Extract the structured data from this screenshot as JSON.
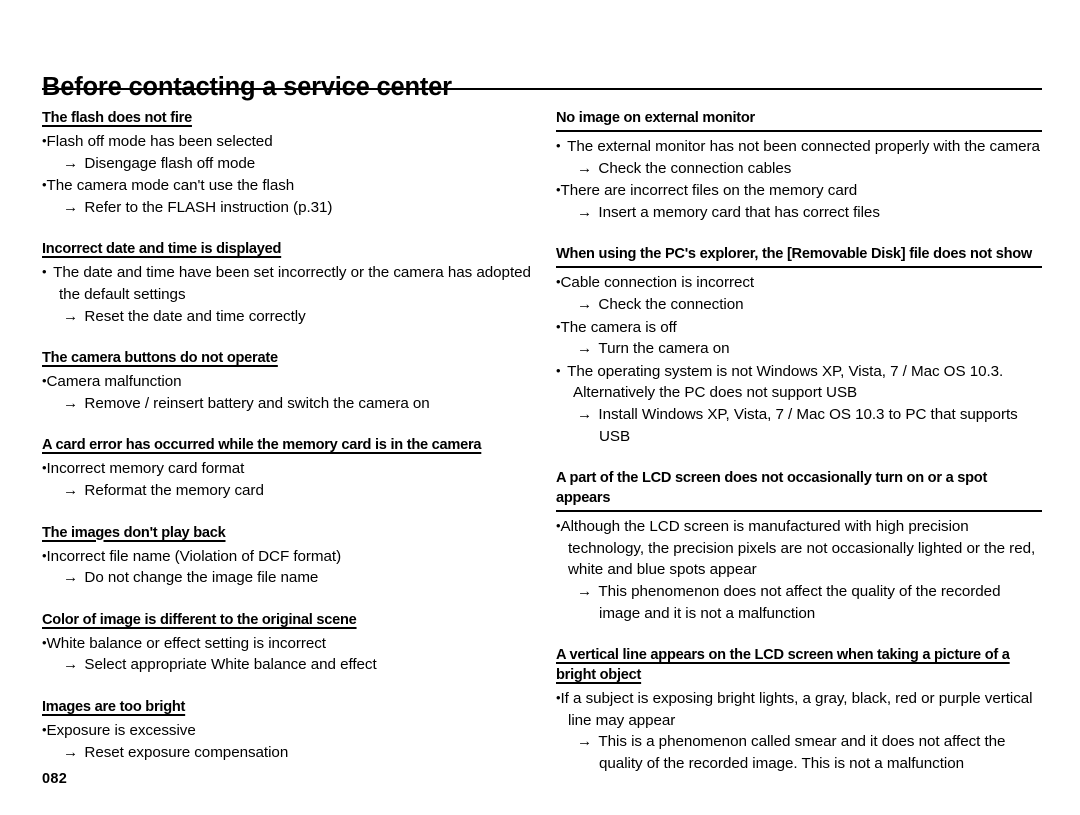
{
  "document": {
    "title": "Before contacting a service center",
    "page_number": "082",
    "bullet_glyph": "•",
    "arrow_glyph": "→"
  },
  "left_column": [
    {
      "heading": "The flash does not fire",
      "heading_style": "underline",
      "items": [
        {
          "type": "bullet",
          "spaced": false,
          "text": "Flash off mode has been selected"
        },
        {
          "type": "arrow",
          "text": "Disengage flash off mode"
        },
        {
          "type": "bullet",
          "spaced": false,
          "text": "The camera mode can't use the flash"
        },
        {
          "type": "arrow",
          "text": "Refer to the FLASH instruction (p.31)"
        }
      ]
    },
    {
      "heading": "Incorrect date and time is displayed",
      "heading_style": "underline",
      "items": [
        {
          "type": "bullet",
          "spaced": true,
          "text": "The date and time have been set incorrectly or the camera has adopted the default settings"
        },
        {
          "type": "arrow",
          "text": "Reset the date and time correctly"
        }
      ]
    },
    {
      "heading": "The camera buttons do not operate",
      "heading_style": "underline",
      "items": [
        {
          "type": "bullet",
          "spaced": false,
          "text": "Camera malfunction"
        },
        {
          "type": "arrow",
          "text": "Remove / reinsert battery and switch the camera on"
        }
      ]
    },
    {
      "heading": "A card error has occurred while the memory card is in the camera",
      "heading_style": "underline",
      "items": [
        {
          "type": "bullet",
          "spaced": false,
          "text": "Incorrect memory card format"
        },
        {
          "type": "arrow",
          "text": "Reformat the memory card"
        }
      ]
    },
    {
      "heading": "The images don't play back",
      "heading_style": "underline",
      "items": [
        {
          "type": "bullet",
          "spaced": false,
          "text": "Incorrect file name (Violation of DCF format)"
        },
        {
          "type": "arrow",
          "text": "Do not change the image file name"
        }
      ]
    },
    {
      "heading": "Color of image is different to the original scene",
      "heading_style": "underline",
      "items": [
        {
          "type": "bullet",
          "spaced": false,
          "text": "White balance or effect setting is incorrect"
        },
        {
          "type": "arrow",
          "text": "Select appropriate White balance and effect"
        }
      ]
    },
    {
      "heading": "Images are too bright",
      "heading_style": "underline",
      "items": [
        {
          "type": "bullet",
          "spaced": false,
          "text": "Exposure is excessive"
        },
        {
          "type": "arrow",
          "text": "Reset exposure compensation"
        }
      ]
    }
  ],
  "right_column": [
    {
      "heading": "No image on external monitor",
      "heading_style": "rule",
      "items": [
        {
          "type": "bullet",
          "spaced": true,
          "text": "The external monitor has not been connected properly with the camera"
        },
        {
          "type": "arrow",
          "text": "Check the connection cables"
        },
        {
          "type": "bullet",
          "spaced": false,
          "text": "There are incorrect files on the memory card"
        },
        {
          "type": "arrow",
          "text": "Insert a memory card that has correct files"
        }
      ]
    },
    {
      "heading": "When using the PC's explorer, the [Removable Disk] file does not show",
      "heading_style": "rule",
      "items": [
        {
          "type": "bullet",
          "spaced": false,
          "text": "Cable connection is incorrect"
        },
        {
          "type": "arrow",
          "text": "Check the connection"
        },
        {
          "type": "bullet",
          "spaced": false,
          "text": "The camera is off"
        },
        {
          "type": "arrow",
          "text": "Turn the camera on"
        },
        {
          "type": "bullet",
          "spaced": true,
          "text": "The operating system is not Windows XP, Vista, 7 / Mac OS 10.3. Alternatively the PC does not support USB"
        },
        {
          "type": "arrow",
          "text": "Install Windows XP, Vista, 7 / Mac OS 10.3 to PC that supports USB"
        }
      ]
    },
    {
      "heading": "A part of the LCD screen does not occasionally turn on or a spot appears",
      "heading_style": "rule",
      "items": [
        {
          "type": "bullet",
          "spaced": false,
          "text": "Although the LCD screen is manufactured with high precision technology, the precision pixels are not occasionally lighted or the red, white and blue spots appear"
        },
        {
          "type": "arrow",
          "text": "This phenomenon does not affect the quality of the recorded image and it is not a malfunction"
        }
      ]
    },
    {
      "heading": "A vertical line appears on the LCD screen when taking a picture of a bright object",
      "heading_style": "underline",
      "items": [
        {
          "type": "bullet",
          "spaced": false,
          "text": "If a subject is exposing bright lights, a gray, black, red or purple vertical line may appear"
        },
        {
          "type": "arrow",
          "text": "This is a phenomenon called smear and it does not affect the quality of the recorded image. This is not a malfunction"
        }
      ]
    }
  ]
}
